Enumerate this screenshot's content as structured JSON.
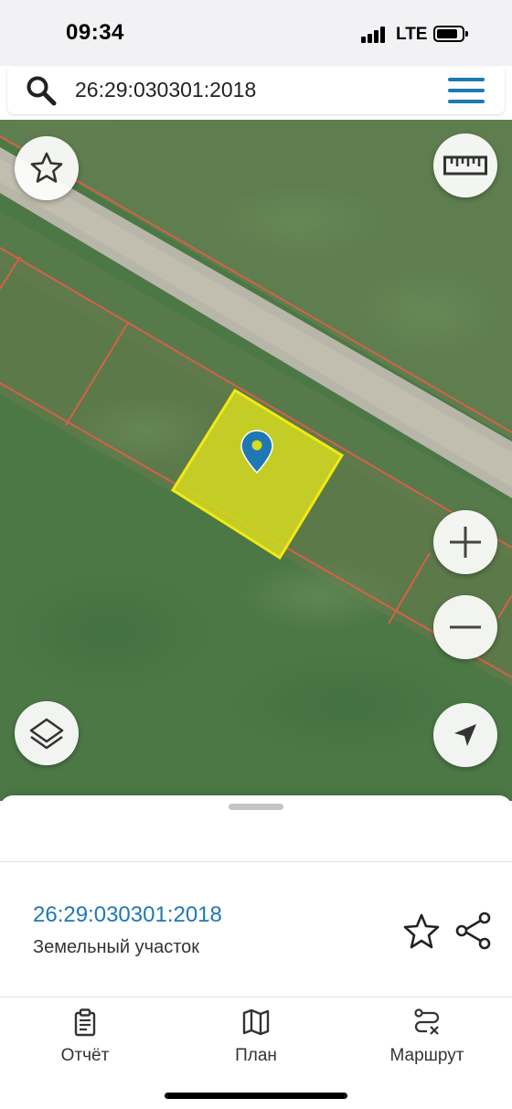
{
  "status_bar": {
    "time": "09:34",
    "network": "LTE",
    "icons": [
      "signal-icon",
      "battery-icon"
    ]
  },
  "search": {
    "value": "26:29:030301:2018",
    "icons": [
      "search-icon",
      "menu-icon"
    ]
  },
  "map": {
    "controls": [
      "favorite-icon",
      "ruler-icon",
      "zoom-in-icon",
      "zoom-out-icon",
      "layers-icon",
      "location-arrow-icon"
    ],
    "colors": {
      "selected_parcel_fill": "#d6dc1e",
      "selected_parcel_stroke": "#f2ea10",
      "parcel_boundary": "#d8604a",
      "marker": "#1f78b4",
      "grass": "#4f7a47",
      "road": "#b9b6a8"
    }
  },
  "sheet": {
    "parcel_number": "26:29:030301:2018",
    "parcel_type": "Земельный участок",
    "icons": [
      "star-outline-icon",
      "share-icon"
    ]
  },
  "nav": {
    "items": [
      {
        "label": "Отчёт",
        "icon": "report-clipboard-icon"
      },
      {
        "label": "План",
        "icon": "map-plan-icon"
      },
      {
        "label": "Маршрут",
        "icon": "route-icon"
      }
    ]
  },
  "colors": {
    "accent": "#1f78b4",
    "status_bar_bg": "#f2f2f4"
  }
}
